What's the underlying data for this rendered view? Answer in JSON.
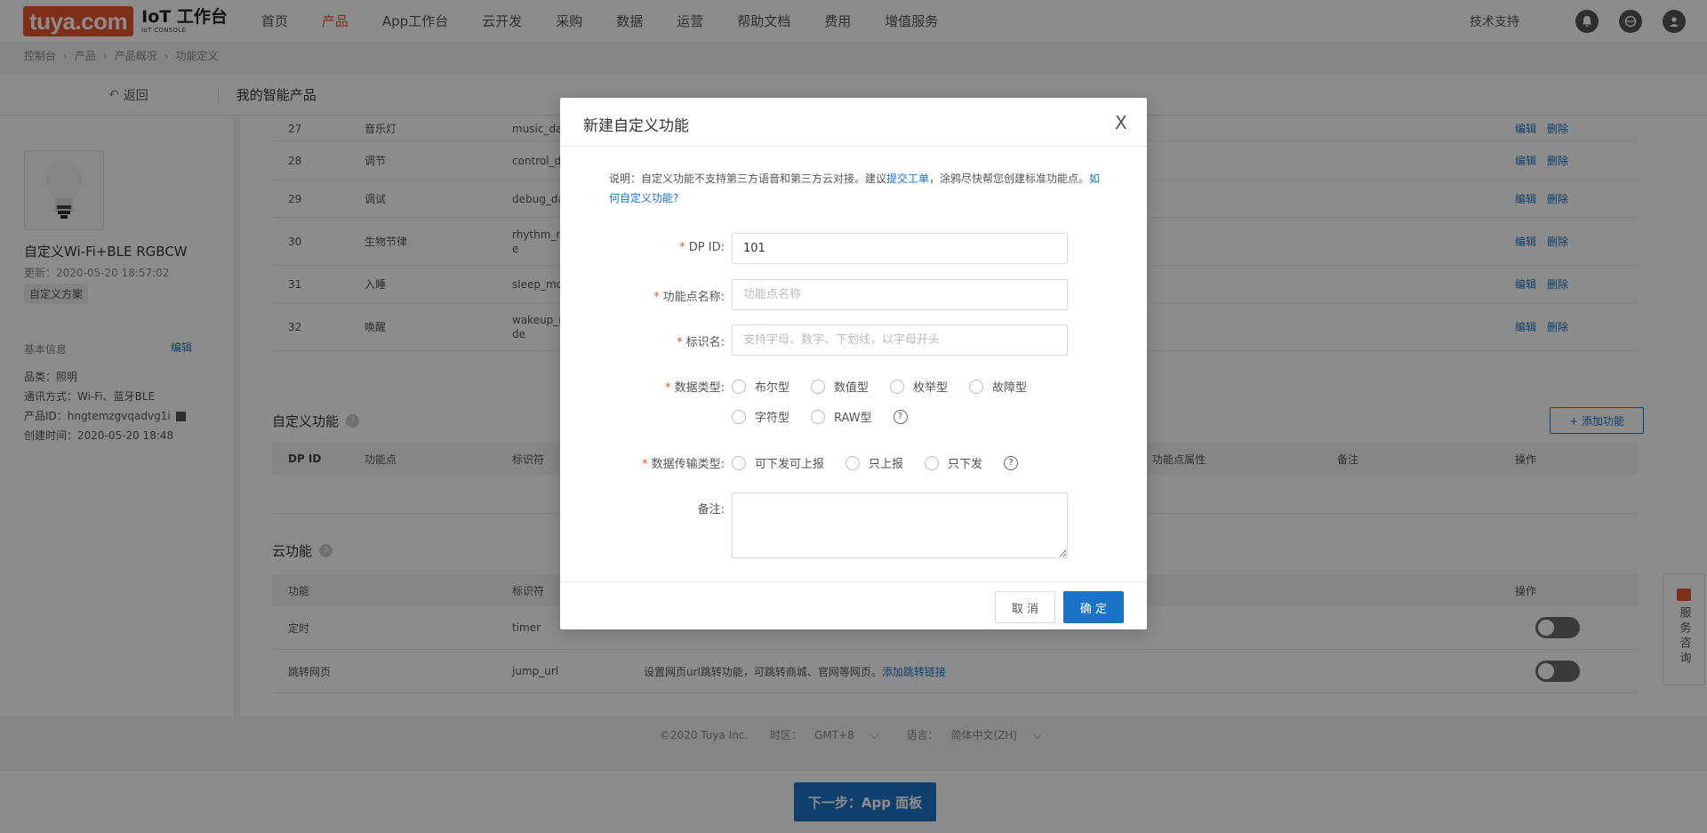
{
  "logo": {
    "brand": "tuya.com",
    "title": "IoT 工作台",
    "subtitle": "IoT CONSOLE"
  },
  "nav": [
    "首页",
    "产品",
    "App工作台",
    "云开发",
    "采购",
    "数据",
    "运营",
    "帮助文档",
    "费用",
    "增值服务"
  ],
  "top_right": {
    "support": "技术支持"
  },
  "breadcrumb": [
    "控制台",
    "产品",
    "产品概况",
    "功能定义"
  ],
  "subheader": {
    "back": "返回",
    "title": "我的智能产品"
  },
  "product": {
    "name": "自定义Wi-Fi+BLE RGBCW",
    "updated": "更新：2020-05-20 18:57:02",
    "tag": "自定义方案",
    "basic_info": "基本信息",
    "edit": "编辑",
    "category": "品类：照明",
    "protocol": "通讯方式：Wi-Fi、蓝牙BLE",
    "pid": "产品ID：hngtemzgvqadvg1i",
    "created": "创建时间：2020-05-20 18:48"
  },
  "std_rows": [
    {
      "id": "27",
      "name": "音乐灯",
      "code": "music_da"
    },
    {
      "id": "28",
      "name": "调节",
      "code": "control_d"
    },
    {
      "id": "29",
      "name": "调试",
      "code": "debug_da"
    },
    {
      "id": "30",
      "name": "生物节律",
      "code": "rhythm_m",
      "code2": "e"
    },
    {
      "id": "31",
      "name": "入睡",
      "code": "sleep_mo"
    },
    {
      "id": "32",
      "name": "唤醒",
      "code": "wakeup_m",
      "code2": "de"
    }
  ],
  "row_actions": {
    "edit": "编辑",
    "delete": "删除"
  },
  "custom_section": {
    "title": "自定义功能",
    "add_button": "+ 添加功能",
    "headers": {
      "dpid": "DP ID",
      "name": "功能点",
      "code": "标识符",
      "prop": "功能点属性",
      "remark": "备注",
      "op": "操作"
    }
  },
  "cloud_section": {
    "title": "云功能",
    "headers": {
      "func": "功能",
      "code": "标识符",
      "op": "操作"
    },
    "rows": [
      {
        "name": "定时",
        "code": "timer",
        "desc": ""
      },
      {
        "name": "跳转网页",
        "code": "jump_url",
        "desc": "设置网页url跳转功能，可跳转商城、官网等网页。",
        "link": "添加跳转链接"
      }
    ]
  },
  "footer": {
    "copyright": "©2020 Tuya Inc.",
    "tz_label": "时区：",
    "tz_value": "GMT+8",
    "lang_label": "语言：",
    "lang_value": "简体中文(ZH)"
  },
  "next_button": "下一步：App 面板",
  "float_service": "服务咨询",
  "modal": {
    "title": "新建自定义功能",
    "close": "X",
    "desc_prefix": "说明：自定义功能不支持第三方语音和第三方云对接。建议",
    "desc_link": "提交工单",
    "desc_middle": "，涂鸦尽快帮您创建标准功能点。",
    "desc_link2": "如何自定义功能?",
    "fields": {
      "dpid_label": "DP ID:",
      "dpid_value": "101",
      "name_label": "功能点名称:",
      "name_placeholder": "功能点名称",
      "code_label": "标识名:",
      "code_placeholder": "支持字母、数字、下划线，以字母开头",
      "type_label": "数据类型:",
      "types": [
        "布尔型",
        "数值型",
        "枚举型",
        "故障型",
        "字符型",
        "RAW型"
      ],
      "transfer_label": "数据传输类型:",
      "transfers": [
        "可下发可上报",
        "只上报",
        "只下发"
      ],
      "remark_label": "备注:"
    },
    "help": "?",
    "cancel": "取 消",
    "ok": "确 定"
  }
}
